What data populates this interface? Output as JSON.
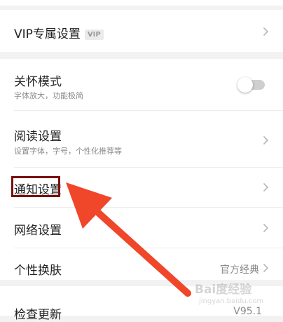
{
  "settings": {
    "vip": {
      "label": "VIP专属设置",
      "badge": "VIP"
    },
    "care_mode": {
      "label": "关怀模式",
      "desc": "字体放大，功能极简",
      "enabled": false
    },
    "reading": {
      "label": "阅读设置",
      "desc": "设置字体，字号，个性化推荐等"
    },
    "notification": {
      "label": "通知设置"
    },
    "network": {
      "label": "网络设置"
    },
    "theme": {
      "label": "个性换肤",
      "value": "官方经典"
    },
    "update": {
      "label": "检查更新",
      "value": "V95.1"
    }
  },
  "icons": {
    "chevron": "chevron-right-icon",
    "annotation_arrow": "red-arrow"
  },
  "colors": {
    "arrow": "#f0462a",
    "highlight_border": "#7a0f0f",
    "background": "#f2f2f2"
  },
  "watermark": {
    "text": "Bai度经验",
    "sub": "jingyan.baidu.com"
  }
}
